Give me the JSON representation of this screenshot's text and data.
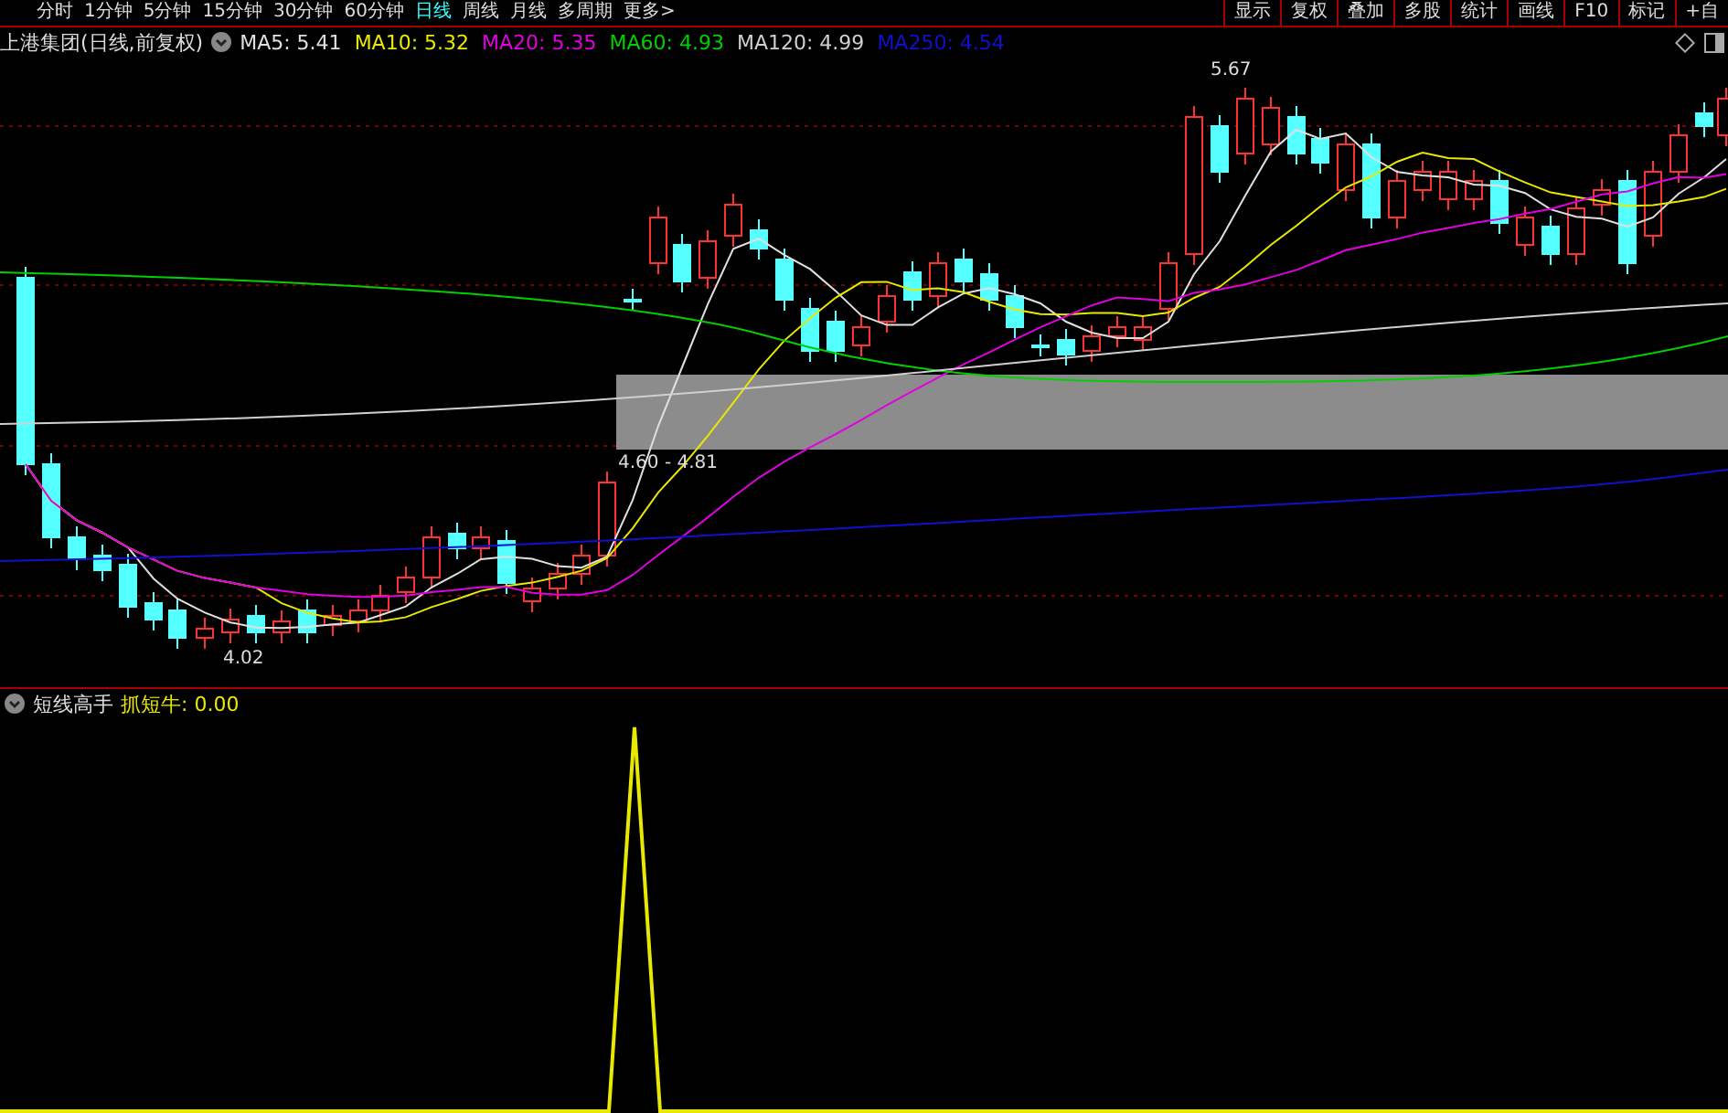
{
  "toolbar": {
    "periods": [
      {
        "label": "分时",
        "selected": false
      },
      {
        "label": "1分钟",
        "selected": false
      },
      {
        "label": "5分钟",
        "selected": false
      },
      {
        "label": "15分钟",
        "selected": false
      },
      {
        "label": "30分钟",
        "selected": false
      },
      {
        "label": "60分钟",
        "selected": false
      },
      {
        "label": "日线",
        "selected": true
      },
      {
        "label": "周线",
        "selected": false
      },
      {
        "label": "月线",
        "selected": false
      },
      {
        "label": "多周期",
        "selected": false
      },
      {
        "label": "更多>",
        "selected": false
      }
    ],
    "tools": [
      "显示",
      "复权",
      "叠加",
      "多股",
      "统计",
      "画线",
      "F10",
      "标记",
      "+自"
    ]
  },
  "main_panel": {
    "title": "上港集团(日线,前复权)",
    "indicators": [
      {
        "label": "MA5: 5.41",
        "color": "#e0e0e0"
      },
      {
        "label": "MA10: 5.32",
        "color": "#e8e800"
      },
      {
        "label": "MA20: 5.35",
        "color": "#e000e0"
      },
      {
        "label": "MA60: 4.93",
        "color": "#00d000"
      },
      {
        "label": "MA120: 4.99",
        "color": "#d0d0d0"
      },
      {
        "label": "MA250: 4.54",
        "color": "#1010d0"
      }
    ],
    "high_label": "5.67",
    "low_label": "4.02",
    "range_label": "4.60 - 4.81"
  },
  "sub_panel": {
    "title": "短线高手",
    "indicators": [
      {
        "label": "抓短牛: 0.00",
        "color": "#e8e800"
      }
    ]
  }
}
